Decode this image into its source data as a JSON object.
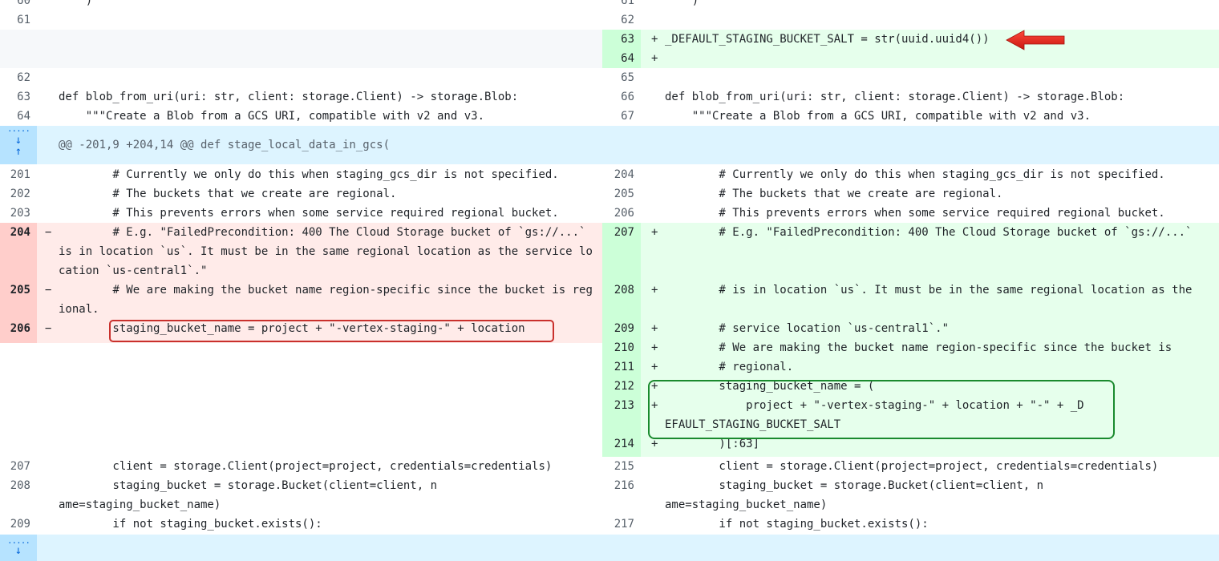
{
  "header_row": {
    "left_num": "60",
    "left_code": "    )",
    "right_num": "61",
    "right_code": "    )"
  },
  "rows": [
    {
      "type": "ctx",
      "left_num": "61",
      "left_code": "",
      "right_num": "62",
      "right_code": ""
    },
    {
      "type": "add",
      "left_num": "",
      "left_code": "",
      "right_num": "63",
      "right_mark": "+",
      "right_code": "_DEFAULT_STAGING_BUCKET_SALT = str(uuid.uuid4())"
    },
    {
      "type": "add",
      "left_num": "",
      "left_code": "",
      "right_num": "64",
      "right_mark": "+",
      "right_code": ""
    },
    {
      "type": "ctx",
      "left_num": "62",
      "left_code": "",
      "right_num": "65",
      "right_code": ""
    },
    {
      "type": "ctx",
      "left_num": "63",
      "left_code": "def blob_from_uri(uri: str, client: storage.Client) -> storage.Blob:",
      "right_num": "66",
      "right_code": "def blob_from_uri(uri: str, client: storage.Client) -> storage.Blob:"
    },
    {
      "type": "ctx",
      "left_num": "64",
      "left_code": "    \"\"\"Create a Blob from a GCS URI, compatible with v2 and v3.",
      "right_num": "67",
      "right_code": "    \"\"\"Create a Blob from a GCS URI, compatible with v2 and v3."
    }
  ],
  "hunk": {
    "text": "@@ -201,9 +204,14 @@ def stage_local_data_in_gcs("
  },
  "block": {
    "ctx_top": [
      {
        "left_num": "201",
        "right_num": "204",
        "code": "        # Currently we only do this when staging_gcs_dir is not specified."
      },
      {
        "left_num": "202",
        "right_num": "205",
        "code": "        # The buckets that we create are regional."
      },
      {
        "left_num": "203",
        "right_num": "206",
        "code": "        # This prevents errors when some service required regional bucket."
      }
    ],
    "deletions": [
      {
        "num": "204",
        "mark": "−",
        "code": "        # E.g. \"FailedPrecondition: 400 The Cloud Storage bucket of `gs://...` is in location `us`. It must be in the same regional location as the service location `us-central1`.\""
      },
      {
        "num": "205",
        "mark": "−",
        "code": "        # We are making the bucket name region-specific since the bucket is regional."
      },
      {
        "num": "206",
        "mark": "−",
        "code": "        staging_bucket_name = project + \"-vertex-staging-\" + location"
      }
    ],
    "additions": [
      {
        "num": "207",
        "mark": "+",
        "code": "        # E.g. \"FailedPrecondition: 400 The Cloud Storage bucket of `gs://...`"
      },
      {
        "num": "208",
        "mark": "+",
        "code": "        # is in location `us`. It must be in the same regional location as the"
      },
      {
        "num": "209",
        "mark": "+",
        "code": "        # service location `us-central1`.\""
      },
      {
        "num": "210",
        "mark": "+",
        "code": "        # We are making the bucket name region-specific since the bucket is"
      },
      {
        "num": "211",
        "mark": "+",
        "code": "        # regional."
      },
      {
        "num": "212",
        "mark": "+",
        "code": "        staging_bucket_name = ("
      },
      {
        "num": "213",
        "mark": "+",
        "code": "            project + \"-vertex-staging-\" + location + \"-\" + _DEFAULT_STAGING_BUCKET_SALT"
      },
      {
        "num": "214",
        "mark": "+",
        "code": "        )[:63]"
      }
    ],
    "ctx_bottom": [
      {
        "left_num": "207",
        "right_num": "215",
        "code": "        client = storage.Client(project=project, credentials=credentials)"
      },
      {
        "left_num": "208",
        "right_num": "216",
        "code": "        staging_bucket = storage.Bucket(client=client, name=staging_bucket_name)"
      },
      {
        "left_num": "209",
        "right_num": "217",
        "code": "        if not staging_bucket.exists():"
      }
    ]
  },
  "colors": {
    "add_bg": "#e6ffec",
    "add_num_bg": "#ccffd8",
    "del_bg": "#ffebe9",
    "del_num_bg": "#ffcecb",
    "hunk_bg": "#ddf4ff",
    "annotation_red": "#c9302c",
    "annotation_green": "#1a8a2e"
  },
  "icons": {
    "expand_down": "arrow-down-icon",
    "expand_up": "arrow-up-icon",
    "annotation_arrow": "red-arrow-icon"
  }
}
